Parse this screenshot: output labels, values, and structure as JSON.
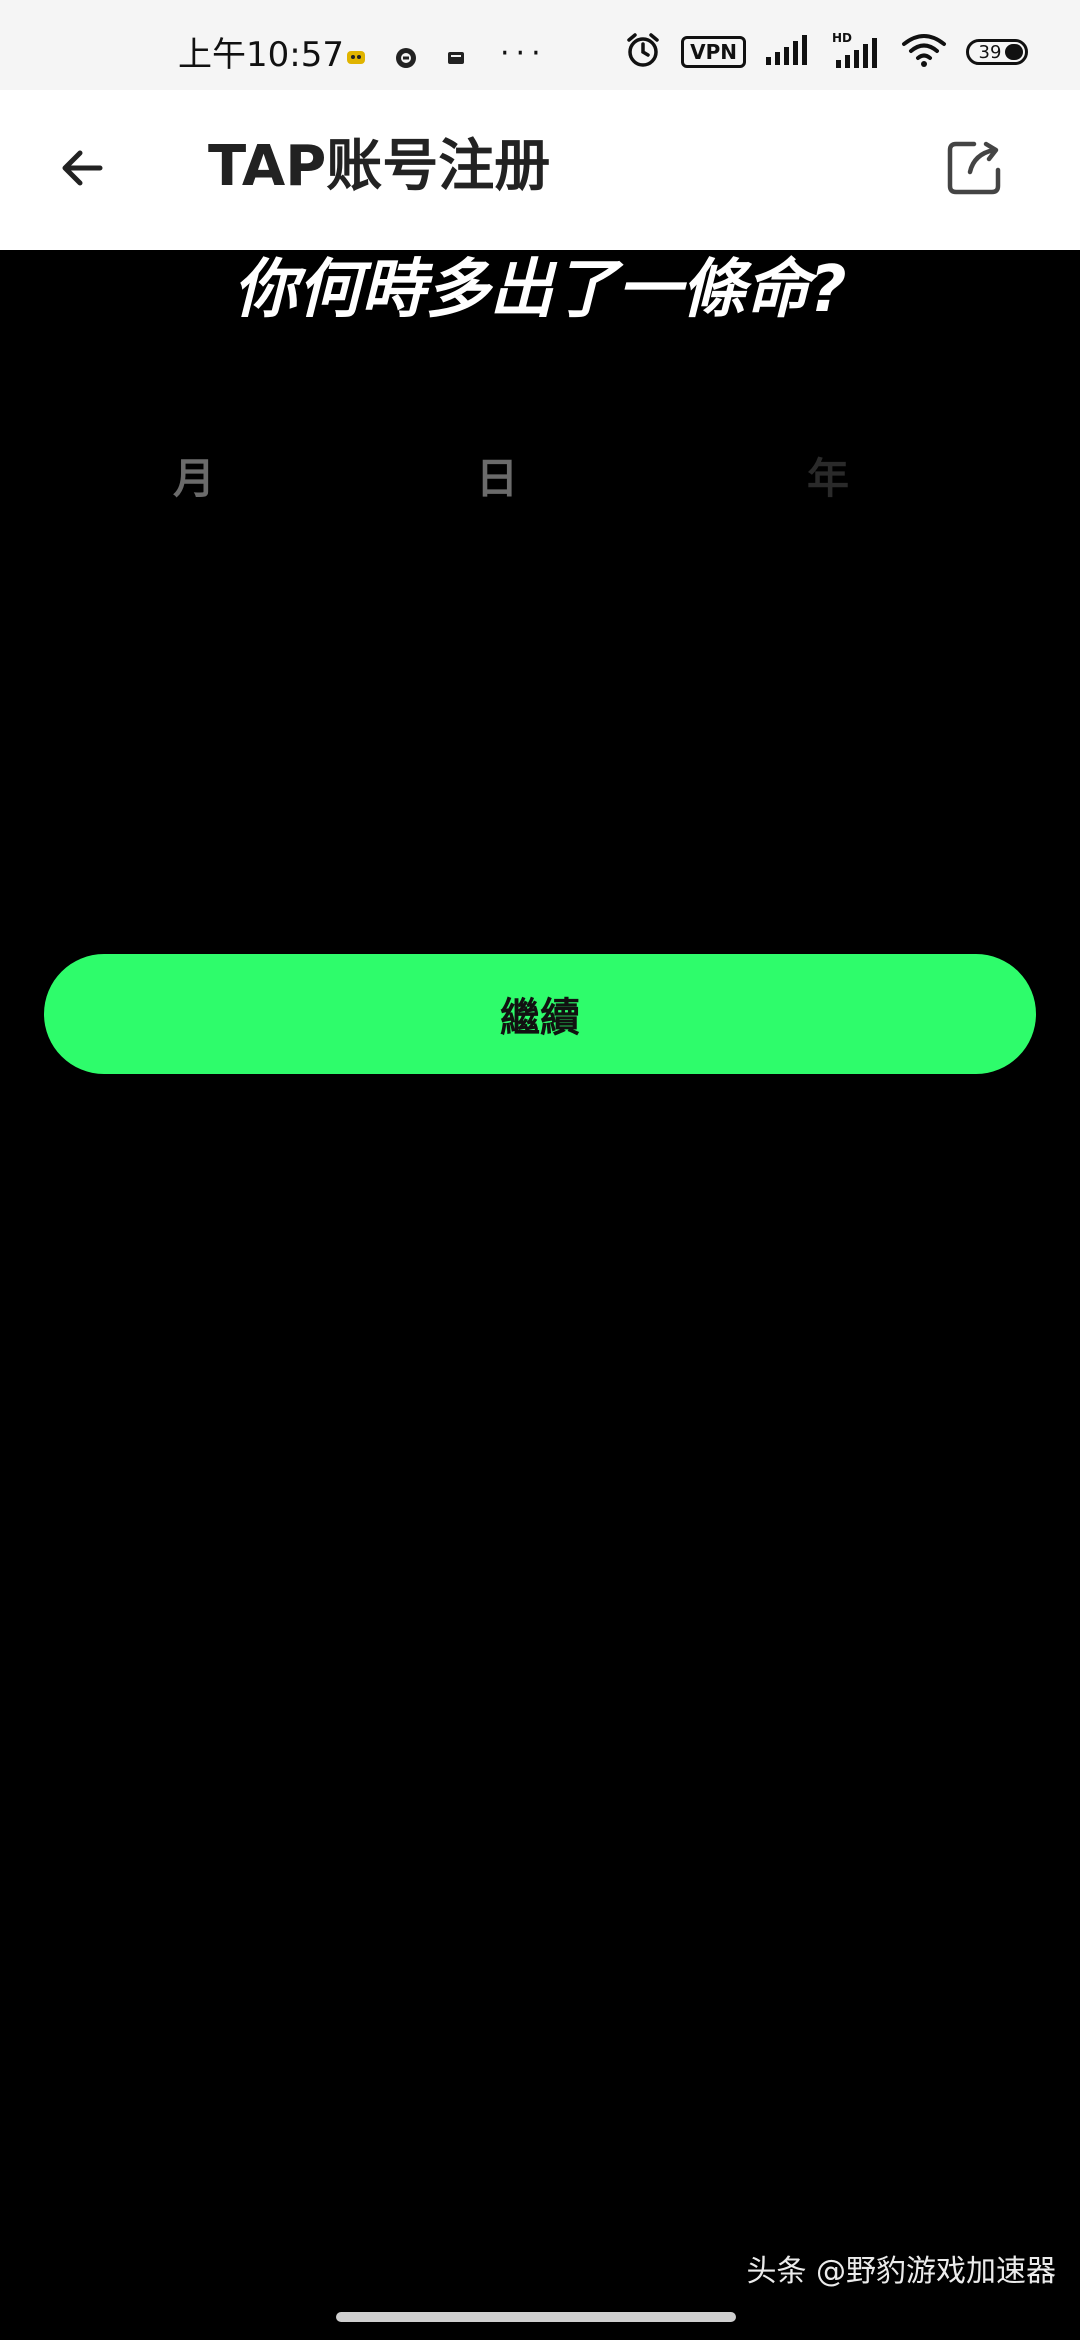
{
  "status_bar": {
    "time": "上午10:57",
    "vpn_label": "VPN",
    "battery_level": "39",
    "icons": [
      "notification-icon-1",
      "notification-icon-2",
      "notification-icon-3",
      "alarm-icon",
      "signal-icon",
      "hd-signal-icon",
      "wifi-icon"
    ],
    "more_indicator": "···"
  },
  "app_bar": {
    "title": "TAP账号注册",
    "back_icon": "arrow-left-icon",
    "share_icon": "share-icon"
  },
  "main": {
    "question": "你何時多出了一條命?",
    "date_picker": {
      "month_label": "月",
      "day_label": "日",
      "year_label": "年"
    },
    "continue_button": "繼續"
  },
  "watermark": "头条 @野豹游戏加速器",
  "colors": {
    "accent": "#2efc6b",
    "background": "#000000",
    "app_bar": "#ffffff"
  }
}
